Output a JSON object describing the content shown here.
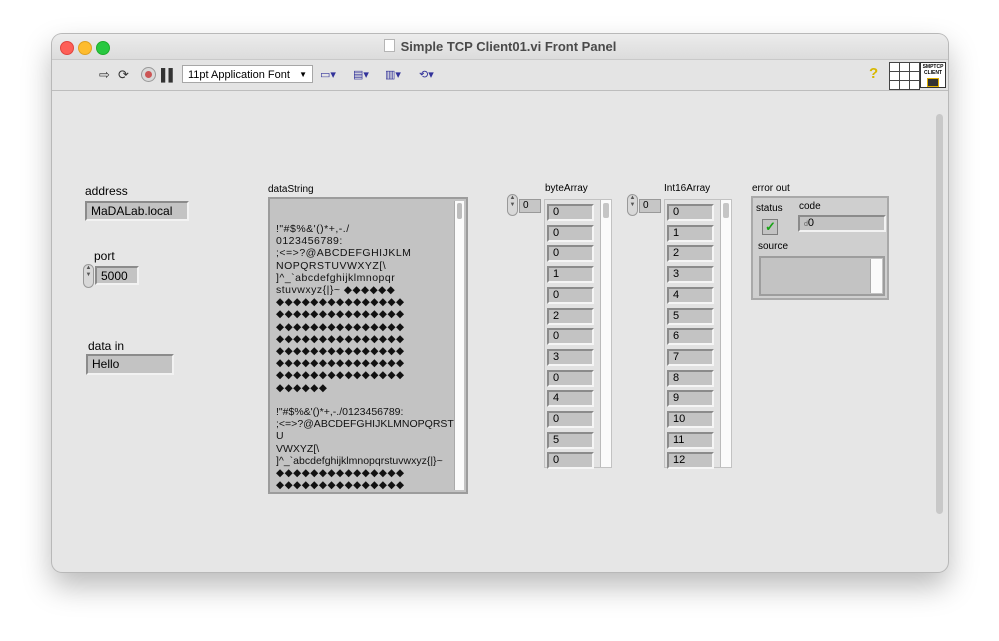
{
  "window": {
    "title": "Simple TCP Client01.vi Front Panel"
  },
  "toolbar": {
    "font": "11pt Application Font",
    "vi_icon_text": "SMPTCP CLIENT"
  },
  "controls": {
    "address": {
      "label": "address",
      "value": "MaDALab.local"
    },
    "port": {
      "label": "port",
      "value": "5000"
    },
    "data_in": {
      "label": "data in",
      "value": "Hello"
    }
  },
  "dataString": {
    "label": "dataString",
    "lines": [
      "!\"#$%&'()*+,-./",
      "0123456789:",
      ";<=>?@ABCDEFGHIJKLM",
      "NOPQRSTUVWXYZ[\\",
      "]^_`abcdefghijklmnopqr",
      "stuvwxyz{|}~ ◆◆◆◆◆◆",
      "◆◆◆◆◆◆◆◆◆◆◆◆◆◆◆",
      "◆◆◆◆◆◆◆◆◆◆◆◆◆◆◆",
      "◆◆◆◆◆◆◆◆◆◆◆◆◆◆◆",
      "◆◆◆◆◆◆◆◆◆◆◆◆◆◆◆",
      "◆◆◆◆◆◆◆◆◆◆◆◆◆◆◆",
      "◆◆◆◆◆◆◆◆◆◆◆◆◆◆◆",
      "◆◆◆◆◆◆◆◆◆◆◆◆◆◆◆",
      "◆◆◆◆◆◆",
      "",
      "!\"#$%&'()*+,-./0123456789:",
      ";<=>?@ABCDEFGHIJKLMNOPQRSTU",
      "VWXYZ[\\",
      "]^_`abcdefghijklmnopqrstuvwxyz{|}~",
      "◆◆◆◆◆◆◆◆◆◆◆◆◆◆◆",
      "◆◆◆◆◆◆◆◆◆◆◆◆◆◆◆",
      "◆◆◆◆◆◆◆◆◆◆◆◆◆◆◆",
      "◆◆◆◆◆◆◆◆◆◆◆◆◆◆◆"
    ]
  },
  "byteArray": {
    "label": "byteArray",
    "index": "0",
    "values": [
      "0",
      "0",
      "0",
      "1",
      "0",
      "2",
      "0",
      "3",
      "0",
      "4",
      "0",
      "5",
      "0"
    ]
  },
  "int16Array": {
    "label": "Int16Array",
    "index": "0",
    "values": [
      "0",
      "1",
      "2",
      "3",
      "4",
      "5",
      "6",
      "7",
      "8",
      "9",
      "10",
      "11",
      "12"
    ]
  },
  "error_out": {
    "label": "error out",
    "status_label": "status",
    "code_label": "code",
    "code_value": "0",
    "source_label": "source",
    "status_ok": true
  }
}
